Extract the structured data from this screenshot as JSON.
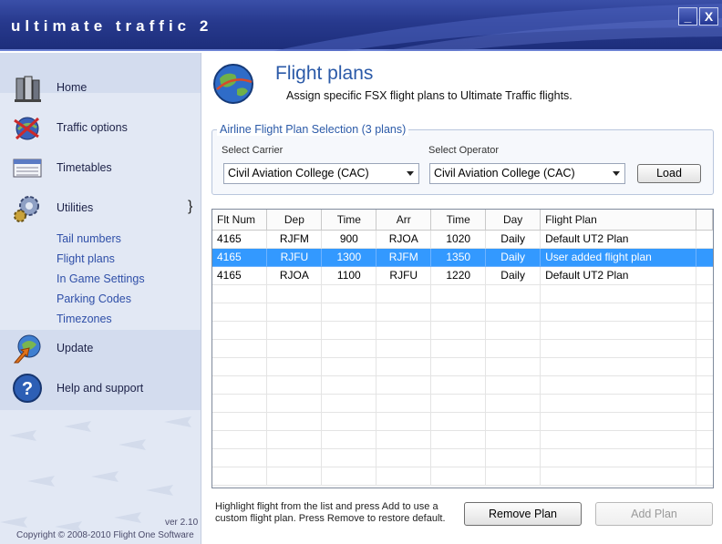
{
  "app": {
    "title": "ultimate traffic 2",
    "minimize": "_",
    "close": "X"
  },
  "sidebar": {
    "items": [
      {
        "label": "Home",
        "icon": "book-icon"
      },
      {
        "label": "Traffic options",
        "icon": "globe-plane-icon"
      },
      {
        "label": "Timetables",
        "icon": "timetable-icon"
      },
      {
        "label": "Utilities",
        "icon": "gears-icon"
      },
      {
        "label": "Update",
        "icon": "update-globe-icon"
      },
      {
        "label": "Help and support",
        "icon": "help-icon"
      }
    ],
    "utilities_bracket": "}",
    "sub_items": [
      "Tail numbers",
      "Flight plans",
      "In Game Settings",
      "Parking Codes",
      "Timezones"
    ],
    "version": "ver 2.10",
    "copyright": "Copyright © 2008-2010 Flight One Software"
  },
  "main": {
    "title": "Flight plans",
    "subtitle": "Assign specific FSX flight plans to Ultimate Traffic flights.",
    "selection": {
      "legend": "Airline Flight Plan Selection (3 plans)",
      "carrier_label": "Select Carrier",
      "carrier_value": "Civil Aviation College (CAC)",
      "operator_label": "Select Operator",
      "operator_value": "Civil Aviation College (CAC)",
      "load_label": "Load"
    },
    "grid": {
      "columns": [
        "Flt Num",
        "Dep",
        "Time",
        "Arr",
        "Time",
        "Day",
        "Flight Plan"
      ],
      "rows": [
        [
          "4165",
          "RJFM",
          "900",
          "RJOA",
          "1020",
          "Daily",
          "Default UT2 Plan"
        ],
        [
          "4165",
          "RJFU",
          "1300",
          "RJFM",
          "1350",
          "Daily",
          "User added flight plan"
        ],
        [
          "4165",
          "RJOA",
          "1100",
          "RJFU",
          "1220",
          "Daily",
          "Default UT2 Plan"
        ]
      ],
      "selected_row": 1
    },
    "hint": "Highlight flight from the list and press Add to use a custom flight plan.  Press Remove to restore default.",
    "remove_label": "Remove Plan",
    "add_label": "Add Plan"
  },
  "colors": {
    "titlebar": "#27398d",
    "accent": "#2b5aa8",
    "selection": "#3399ff",
    "sidebar": "#e2e8f4"
  }
}
